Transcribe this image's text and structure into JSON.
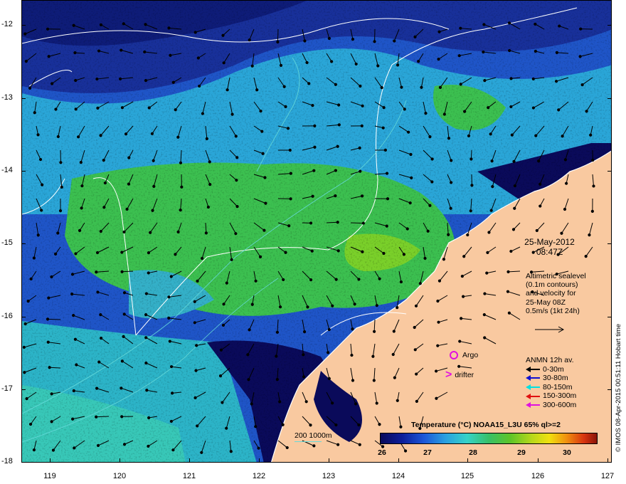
{
  "map": {
    "y_ticks": [
      "-12",
      "-13",
      "-14",
      "-15",
      "-16",
      "-17",
      "-18"
    ],
    "x_ticks": [
      "119",
      "120",
      "121",
      "122",
      "123",
      "124",
      "125",
      "126",
      "127"
    ],
    "date": "25-May-2012",
    "time": "08:47Z",
    "altimetry_lines": [
      "Altimetric sealevel",
      "(0.1m contours)",
      "and velocity for",
      "25-May 08Z",
      "0.5m/s (1kt 24h)"
    ],
    "argo_label": "Argo",
    "drifter_label": "drifter",
    "anmn_title": "ANMN 12h av.",
    "anmn_items": [
      {
        "label": "0-30m",
        "color": "#000000"
      },
      {
        "label": "30-80m",
        "color": "#1010d0"
      },
      {
        "label": "80-150m",
        "color": "#00e0e0"
      },
      {
        "label": "150-300m",
        "color": "#e01010"
      },
      {
        "label": "300-600m",
        "color": "#e010e0"
      }
    ],
    "depth_legend": "200  1000m",
    "colorbar_title": "Temperature (°C) NOAA15_L3U 65% ql>=2",
    "colorbar_ticks": [
      "26",
      "27",
      "28",
      "29",
      "30"
    ],
    "credit": "© IMOS 08-Apr-2015 00:51:11 Hobart time",
    "colors": {
      "land": "#f9c9a0",
      "warm_water": "#3cc050",
      "cold_water": "#1a3ab8",
      "deep_water": "#0a0a5a",
      "contour": "#ffffff",
      "isobath": "#66d9d9"
    }
  }
}
